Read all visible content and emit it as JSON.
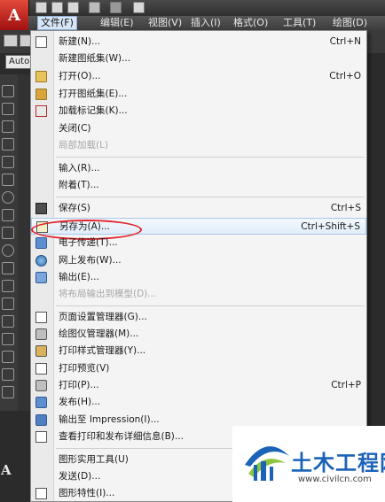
{
  "app": {
    "logo_letter": "A",
    "auto_field": "Auto"
  },
  "menubar": {
    "items": [
      "文件(F)",
      "编辑(E)",
      "视图(V)",
      "插入(I)",
      "格式(O)",
      "工具(T)",
      "绘图(D)"
    ],
    "active_index": 0
  },
  "file_menu": {
    "items": [
      {
        "label": "新建(N)...",
        "shortcut": "Ctrl+N",
        "icon": "new-document-icon",
        "enabled": true
      },
      {
        "label": "新建图纸集(W)...",
        "shortcut": "",
        "icon": "",
        "enabled": true
      },
      {
        "label": "打开(O)...",
        "shortcut": "Ctrl+O",
        "icon": "open-folder-icon",
        "enabled": true
      },
      {
        "label": "打开图纸集(E)...",
        "shortcut": "",
        "icon": "open-sheet-set-icon",
        "enabled": true
      },
      {
        "label": "加载标记集(K)...",
        "shortcut": "",
        "icon": "markup-set-icon",
        "enabled": true
      },
      {
        "label": "关闭(C)",
        "shortcut": "",
        "icon": "",
        "enabled": true
      },
      {
        "label": "局部加载(L)",
        "shortcut": "",
        "icon": "",
        "enabled": false
      },
      {
        "label": "输入(R)...",
        "shortcut": "",
        "icon": "",
        "enabled": true
      },
      {
        "label": "附着(T)...",
        "shortcut": "",
        "icon": "",
        "enabled": true
      },
      {
        "label": "保存(S)",
        "shortcut": "Ctrl+S",
        "icon": "save-disk-icon",
        "enabled": true
      },
      {
        "label": "另存为(A)...",
        "shortcut": "Ctrl+Shift+S",
        "icon": "save-as-icon",
        "enabled": true,
        "highlighted": true
      },
      {
        "label": "电子传递(T)...",
        "shortcut": "",
        "icon": "etransmit-icon",
        "enabled": true
      },
      {
        "label": "网上发布(W)...",
        "shortcut": "",
        "icon": "publish-web-icon",
        "enabled": true
      },
      {
        "label": "输出(E)...",
        "shortcut": "",
        "icon": "export-icon",
        "enabled": true
      },
      {
        "label": "将布局输出到模型(D)...",
        "shortcut": "",
        "icon": "",
        "enabled": false
      },
      {
        "label": "页面设置管理器(G)...",
        "shortcut": "",
        "icon": "page-setup-icon",
        "enabled": true
      },
      {
        "label": "绘图仪管理器(M)...",
        "shortcut": "",
        "icon": "plotter-manager-icon",
        "enabled": true
      },
      {
        "label": "打印样式管理器(Y)...",
        "shortcut": "",
        "icon": "plot-style-icon",
        "enabled": true
      },
      {
        "label": "打印预览(V)",
        "shortcut": "",
        "icon": "print-preview-icon",
        "enabled": true
      },
      {
        "label": "打印(P)...",
        "shortcut": "Ctrl+P",
        "icon": "print-icon",
        "enabled": true
      },
      {
        "label": "发布(H)...",
        "shortcut": "",
        "icon": "publish-icon",
        "enabled": true
      },
      {
        "label": "输出至 Impression(I)...",
        "shortcut": "",
        "icon": "impression-icon",
        "enabled": true
      },
      {
        "label": "查看打印和发布详细信息(B)...",
        "shortcut": "",
        "icon": "plot-details-icon",
        "enabled": true
      },
      {
        "label": "图形实用工具(U)",
        "shortcut": "",
        "icon": "",
        "enabled": true
      },
      {
        "label": "发送(D)...",
        "shortcut": "",
        "icon": "",
        "enabled": true
      },
      {
        "label": "图形特性(I)...",
        "shortcut": "",
        "icon": "drawing-properties-icon",
        "enabled": true
      }
    ]
  },
  "watermark": {
    "title": "土木工程网",
    "url": "www.civilcn.com"
  },
  "colors": {
    "highlight_border": "#a8c8ec",
    "annotation_circle": "#e0242a",
    "watermark_blue": "#1c63b8"
  }
}
